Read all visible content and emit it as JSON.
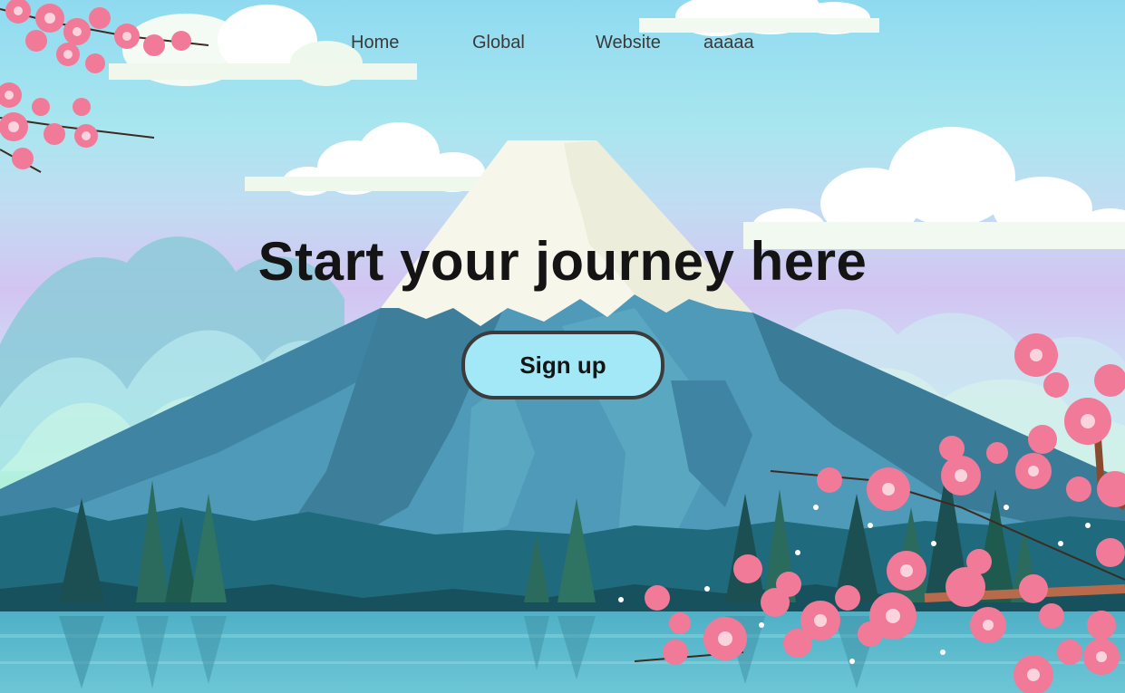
{
  "nav": {
    "items": [
      {
        "label": "Home"
      },
      {
        "label": "Global"
      },
      {
        "label": "Website"
      },
      {
        "label": "aaaaa"
      }
    ]
  },
  "hero": {
    "title": "Start your journey here",
    "cta_label": "Sign up"
  },
  "colors": {
    "sky_top": "#8fdaf0",
    "sky_violet": "#d3c4f2",
    "mountain": "#4f9ab8",
    "mountain_dark": "#2f7393",
    "snow": "#f4f6e6",
    "forest": "#1f5a5e",
    "lake": "#57b6cc",
    "blossom": "#f07a98",
    "button_bg": "#a3e8f6",
    "title_text": "#141414"
  }
}
